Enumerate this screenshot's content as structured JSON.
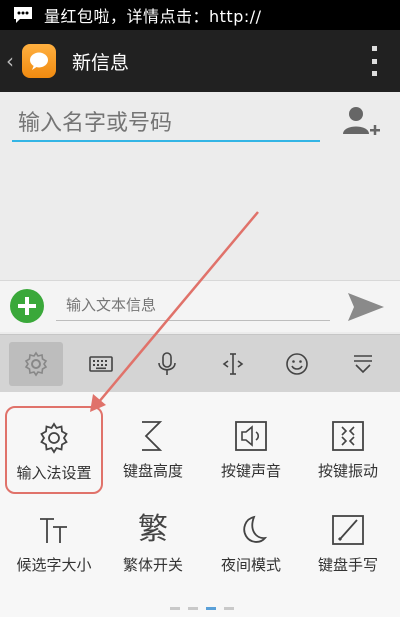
{
  "status_bar": {
    "notification": "量红包啦，详情点击：http://"
  },
  "action_bar": {
    "title": "新信息"
  },
  "recipient": {
    "placeholder": "输入名字或号码"
  },
  "message": {
    "placeholder": "输入文本信息"
  },
  "keyboard_toolbar": {
    "items": [
      {
        "icon": "gear-icon",
        "active": true
      },
      {
        "icon": "keyboard-icon"
      },
      {
        "icon": "microphone-icon"
      },
      {
        "icon": "cursor-icon"
      },
      {
        "icon": "emoji-icon"
      },
      {
        "icon": "collapse-icon"
      }
    ]
  },
  "keyboard_panel": {
    "items": [
      {
        "label": "输入法设置",
        "icon": "gear-icon",
        "highlighted": true
      },
      {
        "label": "键盘高度",
        "icon": "height-icon"
      },
      {
        "label": "按键声音",
        "icon": "speaker-icon"
      },
      {
        "label": "按键振动",
        "icon": "vibrate-icon"
      },
      {
        "label": "候选字大小",
        "icon": "font-size-icon"
      },
      {
        "label": "繁体开关",
        "icon": "traditional-icon",
        "glyph": "繁"
      },
      {
        "label": "夜间模式",
        "icon": "moon-icon"
      },
      {
        "label": "键盘手写",
        "icon": "handwrite-icon"
      }
    ],
    "page_count": 3,
    "active_page": 2
  },
  "colors": {
    "accent": "#33b5e5",
    "highlight": "#e0726a",
    "action_bar": "#212121",
    "attach": "#3aa83a"
  }
}
